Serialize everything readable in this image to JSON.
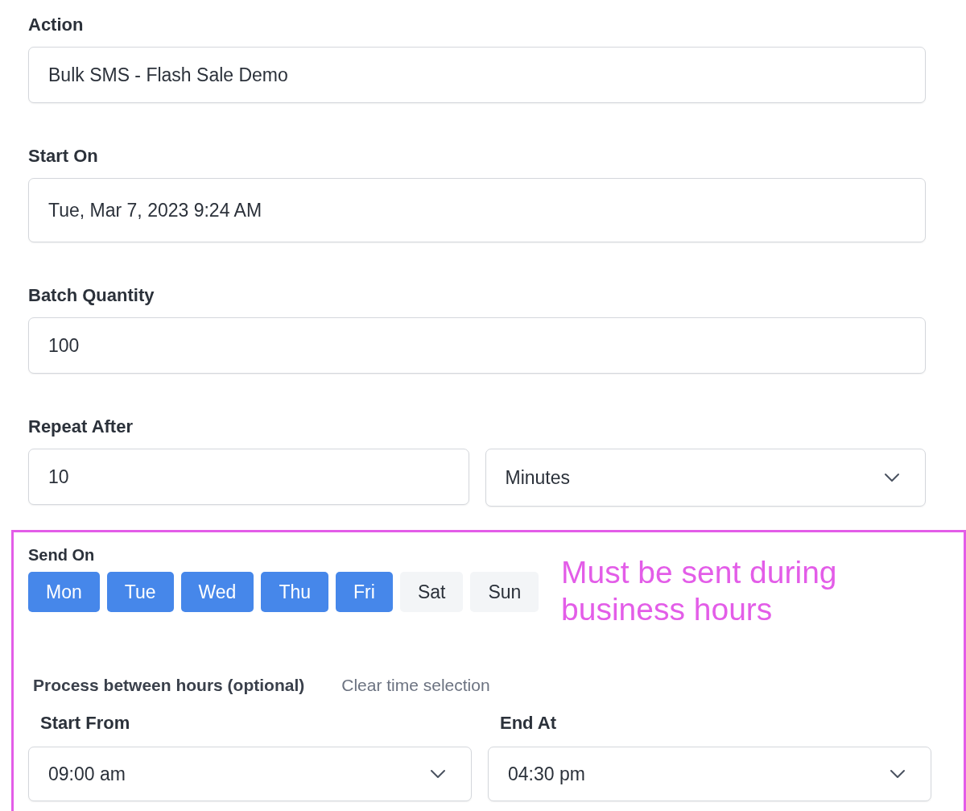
{
  "fields": [
    {
      "kind": "input",
      "label": "Action",
      "value": "Bulk SMS - Flash Sale Demo"
    },
    {
      "kind": "datetime",
      "label": "Start On",
      "value": "Tue, Mar 7, 2023 9:24 AM"
    },
    {
      "kind": "input",
      "label": "Batch Quantity",
      "value": "100"
    }
  ],
  "repeat_after": {
    "label": "Repeat After",
    "amount": "10",
    "unit": "Minutes"
  },
  "send_on": {
    "label": "Send On",
    "days": [
      {
        "label": "Mon",
        "selected": true
      },
      {
        "label": "Tue",
        "selected": true
      },
      {
        "label": "Wed",
        "selected": true
      },
      {
        "label": "Thu",
        "selected": true
      },
      {
        "label": "Fri",
        "selected": true
      },
      {
        "label": "Sat",
        "selected": false
      },
      {
        "label": "Sun",
        "selected": false
      }
    ]
  },
  "annotation": "Must be sent during business hours",
  "hours": {
    "label": "Process between hours (optional)",
    "clear_link": "Clear time selection",
    "start": {
      "label": "Start From",
      "value": "09:00 am"
    },
    "end": {
      "label": "End At",
      "value": "04:30 pm"
    }
  }
}
